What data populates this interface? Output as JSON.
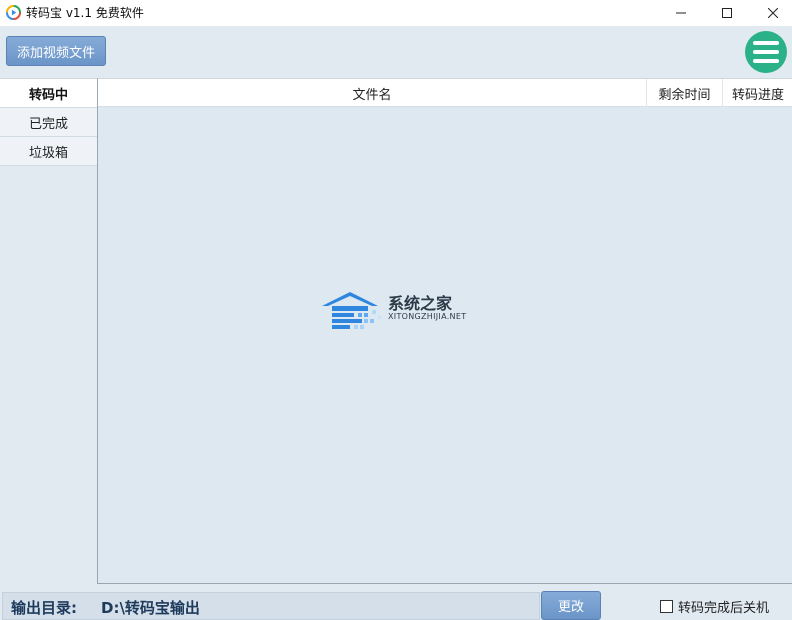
{
  "window": {
    "title": "转码宝 v1.1 免费软件",
    "controls": {
      "minimize": "minimize-icon",
      "maximize": "maximize-icon",
      "close": "close-icon"
    }
  },
  "toolbar": {
    "add_video_label": "添加视频文件",
    "menu_icon": "hamburger-menu-icon",
    "menu_color": "#2bb187",
    "button_color": "#7aa1d1"
  },
  "sidebar": {
    "items": [
      {
        "label": "转码中",
        "active": true
      },
      {
        "label": "已完成",
        "active": false
      },
      {
        "label": "垃圾箱",
        "active": false
      }
    ]
  },
  "table": {
    "columns": [
      "文件名",
      "剩余时间",
      "转码进度"
    ],
    "rows": []
  },
  "watermark": {
    "title": "系统之家",
    "subtitle": "XITONGZHIJIA.NET"
  },
  "statusbar": {
    "output_label": "输出目录:",
    "output_path": "D:\\转码宝输出",
    "change_label": "更改",
    "shutdown_label": "转码完成后关机",
    "shutdown_checked": false
  }
}
